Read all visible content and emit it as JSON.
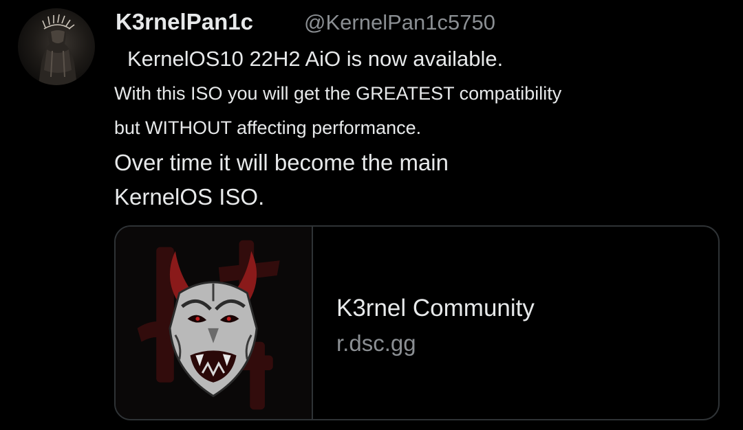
{
  "tweet": {
    "author": {
      "display_name": "K3rnelPan1c",
      "handle": "@KernelPan1c5750"
    },
    "text_lines": [
      " KernelOS10 22H2 AiO is now available.",
      "With this ISO you will get the GREATEST compatibility",
      "but WITHOUT affecting performance.",
      "Over time it will become the main",
      "KernelOS ISO."
    ],
    "link_card": {
      "title": "K3rnel Community",
      "domain": "r.dsc.gg",
      "thumbnail_icon": "oni-mask-icon"
    }
  },
  "colors": {
    "background": "#000000",
    "primary_text": "#e7e9ea",
    "secondary_text": "#8b8f93",
    "card_border": "#2f3336",
    "mask_red": "#8a1a1a"
  }
}
